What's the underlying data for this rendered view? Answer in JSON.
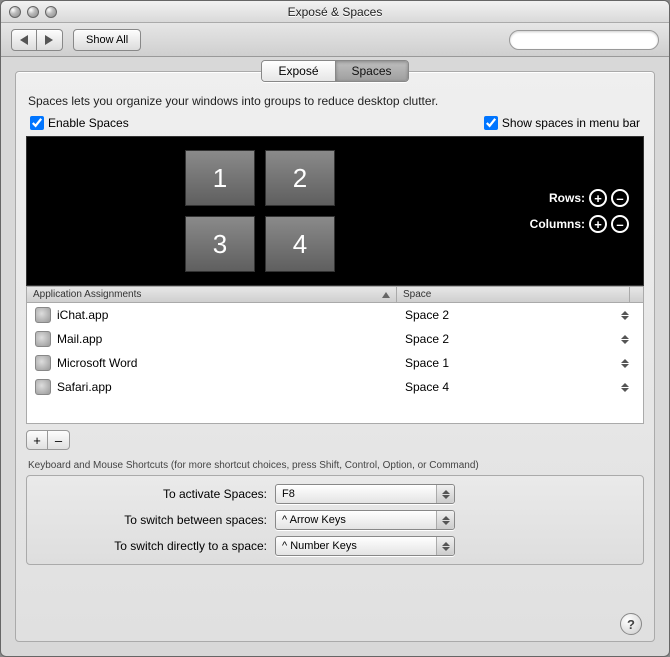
{
  "window": {
    "title": "Exposé & Spaces"
  },
  "toolbar": {
    "show_all": "Show All",
    "search_placeholder": ""
  },
  "tabs": {
    "expose": "Exposé",
    "spaces": "Spaces"
  },
  "description": "Spaces lets you organize your windows into groups to reduce desktop clutter.",
  "checkboxes": {
    "enable": "Enable Spaces",
    "menubar": "Show spaces in menu bar"
  },
  "grid": {
    "cells": [
      "1",
      "2",
      "3",
      "4"
    ],
    "rows_label": "Rows:",
    "cols_label": "Columns:"
  },
  "table": {
    "col_app": "Application Assignments",
    "col_space": "Space",
    "rows": [
      {
        "app": "iChat.app",
        "space": "Space 2"
      },
      {
        "app": "Mail.app",
        "space": "Space 2"
      },
      {
        "app": "Microsoft Word",
        "space": "Space 1"
      },
      {
        "app": "Safari.app",
        "space": "Space 4"
      }
    ]
  },
  "buttons": {
    "add": "+",
    "remove": "–"
  },
  "shortcuts": {
    "heading": "Keyboard and Mouse Shortcuts (for more shortcut choices, press Shift, Control, Option, or Command)",
    "activate_label": "To activate Spaces:",
    "activate_value": "F8",
    "switch_label": "To switch between spaces:",
    "switch_value": "^ Arrow Keys",
    "direct_label": "To switch directly to a space:",
    "direct_value": "^ Number Keys"
  },
  "help": "?"
}
